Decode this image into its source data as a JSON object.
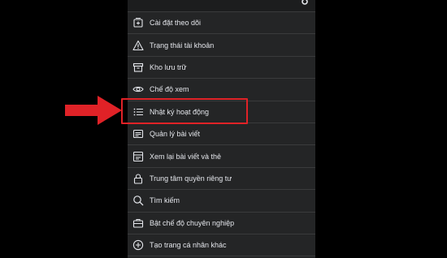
{
  "menu": {
    "items": [
      {
        "label": "Cài đặt theo dõi",
        "icon": "follow-settings-icon"
      },
      {
        "label": "Trạng thái tài khoản",
        "icon": "warning-icon"
      },
      {
        "label": "Kho lưu trữ",
        "icon": "archive-icon"
      },
      {
        "label": "Chế độ xem",
        "icon": "eye-icon"
      },
      {
        "label": "Nhật ký hoạt động",
        "icon": "list-icon"
      },
      {
        "label": "Quản lý bài viết",
        "icon": "post-icon"
      },
      {
        "label": "Xem lại bài viết và thẻ",
        "icon": "review-icon"
      },
      {
        "label": "Trung tâm quyền riêng tư",
        "icon": "lock-icon"
      },
      {
        "label": "Tìm kiếm",
        "icon": "search-icon"
      },
      {
        "label": "Bật chế độ chuyên nghiệp",
        "icon": "briefcase-icon"
      },
      {
        "label": "Tạo trang cá nhân khác",
        "icon": "plus-circle-icon"
      }
    ]
  },
  "colors": {
    "background": "#000000",
    "panel": "#242526",
    "divider": "#3a3b3c",
    "text": "#e4e6eb",
    "highlight": "#e02227"
  }
}
